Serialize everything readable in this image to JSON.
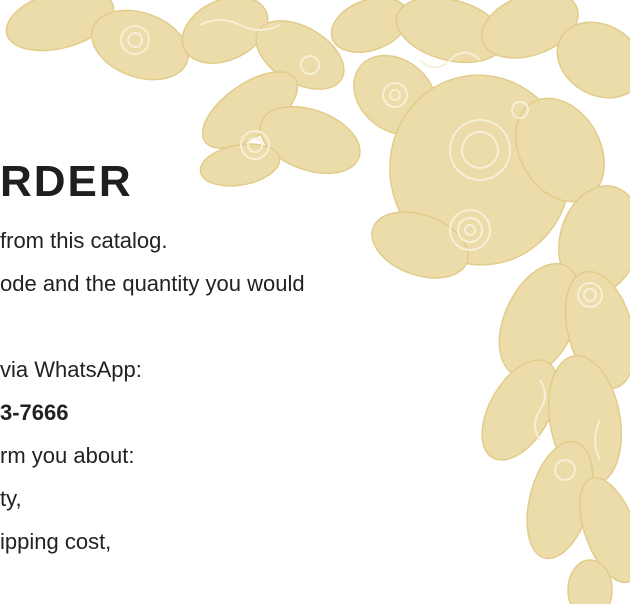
{
  "heading": "RDER",
  "lines": [
    "from this catalog.",
    "ode and the quantity you would",
    "via WhatsApp:",
    "3-7666",
    "rm you about:",
    "ty,",
    "ipping cost,"
  ],
  "ornament": {
    "name": "batik-floral-ornament",
    "color": "#e8d59c"
  }
}
